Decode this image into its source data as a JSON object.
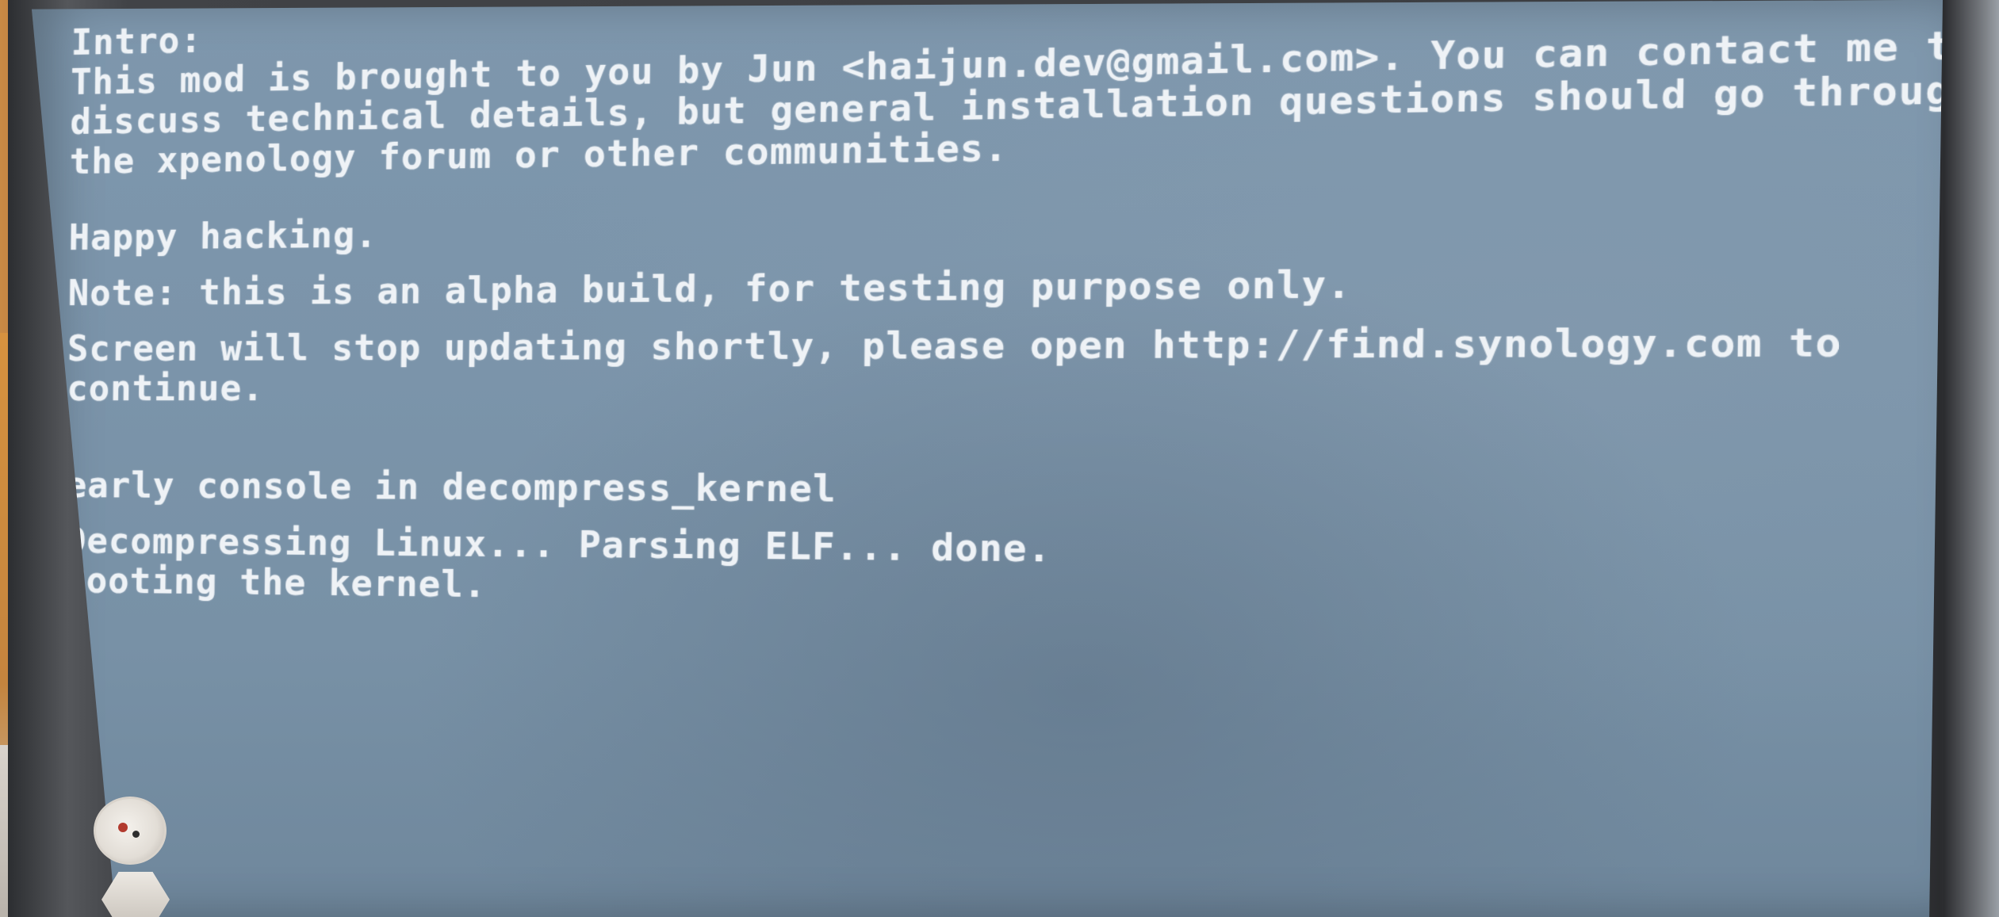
{
  "console": {
    "lines": [
      "Intro:",
      "This mod is brought to you by Jun <haijun.dev@gmail.com>. You can contact me to",
      "discuss technical details, but general installation questions should go through",
      "the xpenology forum or other communities.",
      "Happy hacking.",
      "Note: this is an alpha build, for testing purpose only.",
      "Screen will stop updating shortly, please open http://find.synology.com to",
      "continue.",
      "early console in decompress_kernel",
      "Decompressing Linux... Parsing ELF... done.",
      "Booting the kernel."
    ]
  },
  "colors": {
    "screen_background": "#7e97ad",
    "console_text": "#eef2f6",
    "bezel": "#3b3d40"
  }
}
